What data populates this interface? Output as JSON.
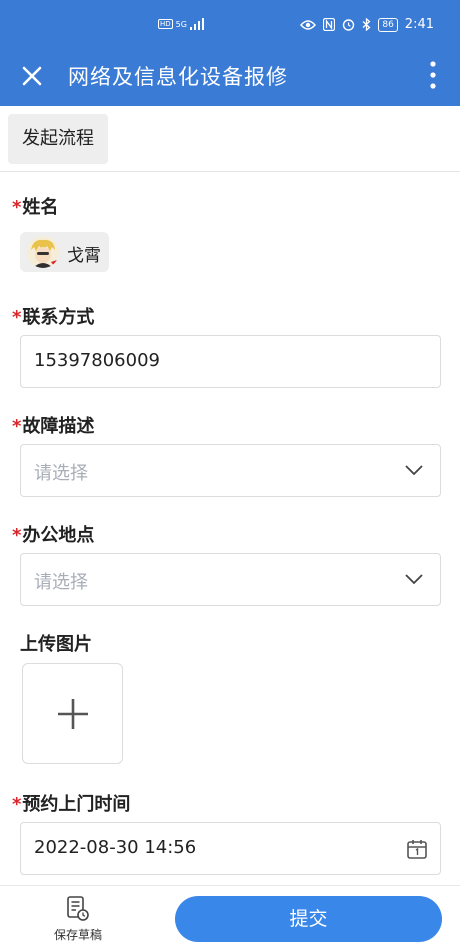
{
  "status_bar": {
    "network_badge": "HD",
    "network_type": "5G",
    "battery": "86",
    "time": "2:41"
  },
  "titlebar": {
    "title": "网络及信息化设备报修"
  },
  "actions": {
    "start_process": "发起流程"
  },
  "form": {
    "required_mark": "*",
    "name": {
      "label": "姓名",
      "value": "戈霄"
    },
    "contact": {
      "label": "联系方式",
      "value": "15397806009"
    },
    "fault": {
      "label": "故障描述",
      "placeholder": "请选择"
    },
    "office": {
      "label": "办公地点",
      "placeholder": "请选择"
    },
    "upload": {
      "label": "上传图片"
    },
    "appointment": {
      "label": "预约上门时间",
      "value": "2022-08-30 14:56"
    }
  },
  "bottom": {
    "save_draft": "保存草稿",
    "submit": "提交"
  },
  "colors": {
    "header": "#3a7bd5",
    "submit": "#3a87ea",
    "required": "#d9252b",
    "placeholder": "#a8aeb8"
  },
  "icons": {
    "close": "close-icon",
    "more": "more-vertical-icon",
    "chevron": "chevron-down-icon",
    "calendar": "calendar-icon",
    "plus": "plus-icon",
    "draft": "draft-icon"
  }
}
